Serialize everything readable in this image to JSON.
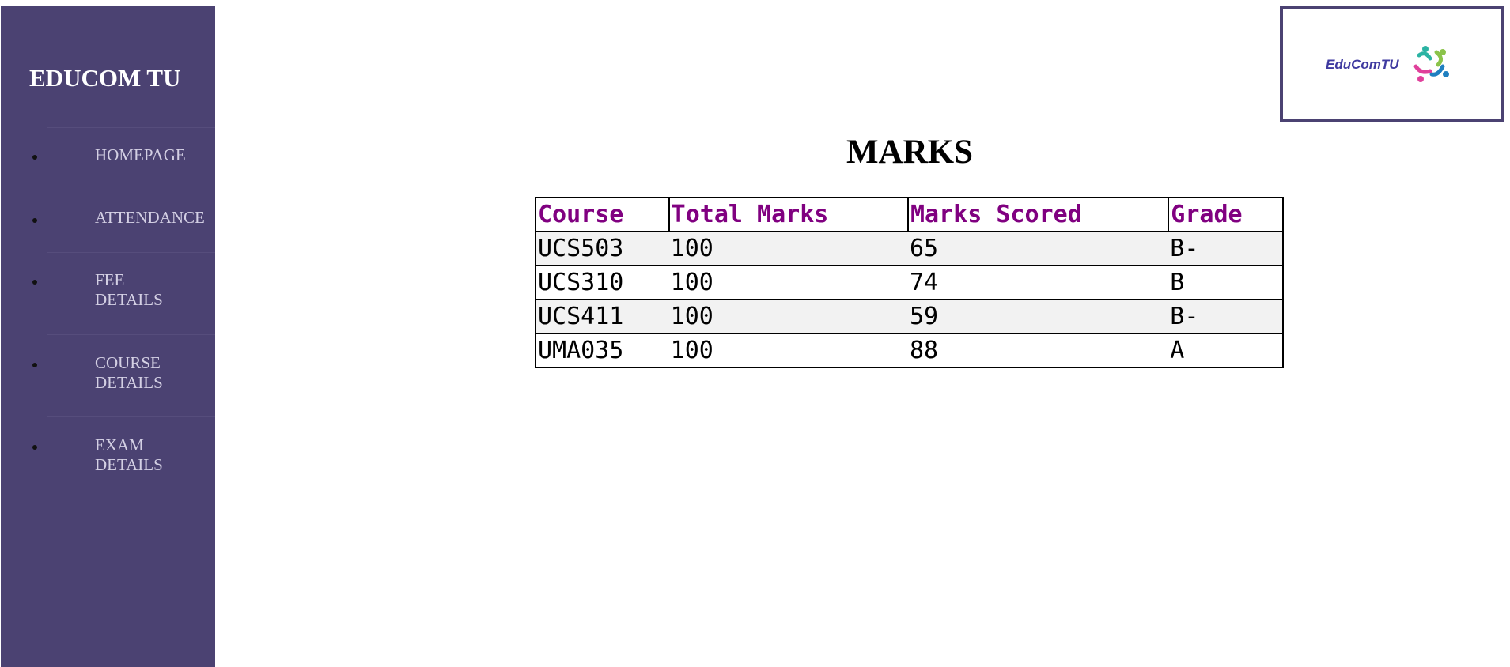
{
  "sidebar": {
    "brand": "EDUCOM TU",
    "items": [
      {
        "label": "HOMEPAGE"
      },
      {
        "label": "ATTENDANCE"
      },
      {
        "label": "FEE DETAILS"
      },
      {
        "label": "COURSE DETAILS"
      },
      {
        "label": "EXAM DETAILS"
      }
    ]
  },
  "logo": {
    "text": "EduComTU"
  },
  "main": {
    "title": "MARKS",
    "table": {
      "headers": [
        "Course",
        "Total Marks",
        "Marks Scored",
        "Grade"
      ],
      "rows": [
        [
          "UCS503",
          "100",
          "65",
          "B-"
        ],
        [
          "UCS310",
          "100",
          "74",
          "B"
        ],
        [
          "UCS411",
          "100",
          "59",
          "B-"
        ],
        [
          "UMA035",
          "100",
          "88",
          "A"
        ]
      ]
    }
  },
  "colors": {
    "sidebar_bg": "#4b4272",
    "header_text": "#800080",
    "nav_text": "#d4d0e4",
    "logo_text": "#3f3aa0"
  }
}
